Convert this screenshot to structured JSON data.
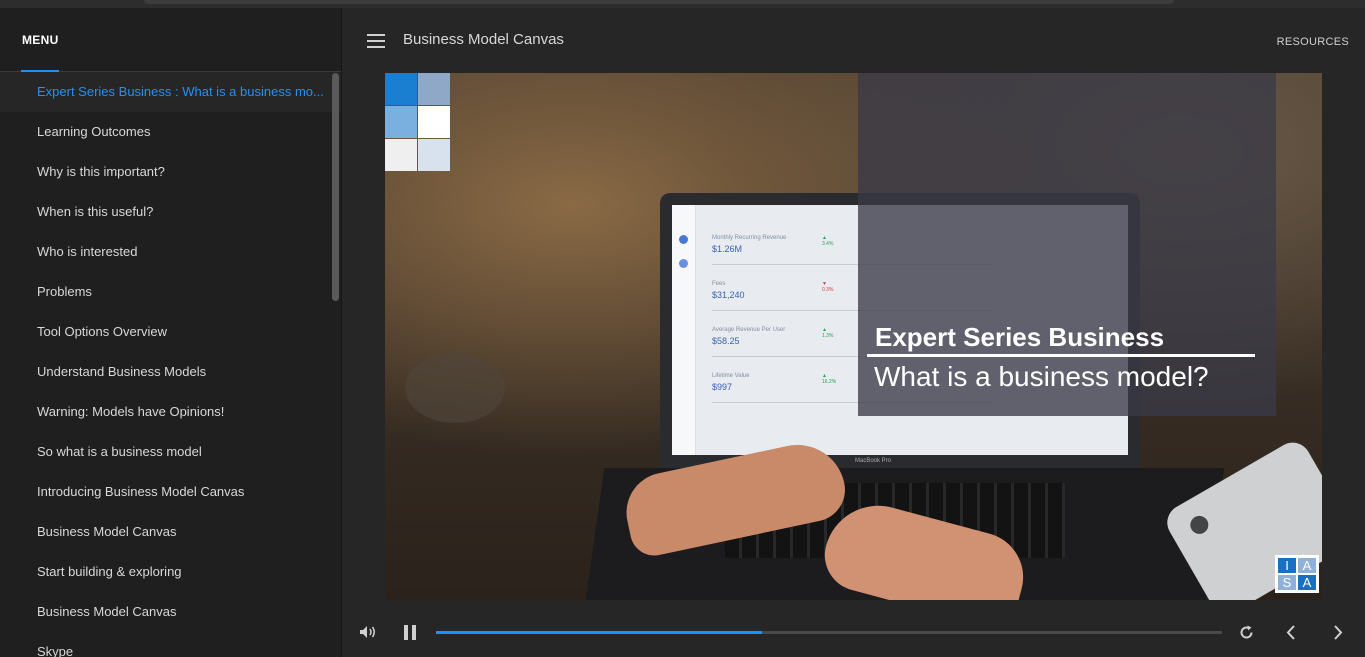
{
  "sidebar": {
    "menu_title": "MENU",
    "items": [
      {
        "label": "Expert Series Business : What is a business mo...",
        "active": true
      },
      {
        "label": "Learning Outcomes"
      },
      {
        "label": "Why is this important?"
      },
      {
        "label": "When is this useful?"
      },
      {
        "label": "Who is interested"
      },
      {
        "label": "Problems"
      },
      {
        "label": "Tool Options Overview"
      },
      {
        "label": "Understand Business Models"
      },
      {
        "label": "Warning: Models have Opinions!"
      },
      {
        "label": "So what is a business model"
      },
      {
        "label": "Introducing Business Model Canvas"
      },
      {
        "label": "Business Model Canvas"
      },
      {
        "label": "Start building & exploring"
      },
      {
        "label": "Business Model Canvas"
      },
      {
        "label": "Skype"
      }
    ]
  },
  "header": {
    "title": "Business Model Canvas",
    "resources_label": "RESOURCES"
  },
  "slide": {
    "title": "Expert Series Business",
    "subtitle": "What is a business model?",
    "logo_letters": [
      "I",
      "A",
      "S",
      "A"
    ],
    "laptop_brand": "MacBook Pro",
    "metrics": [
      {
        "label": "Monthly Recurring Revenue",
        "value": "$1.26M",
        "delta": "▲ 3.4%"
      },
      {
        "label": "Fees",
        "value": "$31,240",
        "delta": "▼ 0.3%"
      },
      {
        "label": "Average Revenue Per User",
        "value": "$58.25",
        "delta": "▲ 1.3%"
      },
      {
        "label": "Lifetime Value",
        "value": "$997",
        "delta": "▲ 16.2%"
      }
    ]
  },
  "player": {
    "progress": 0.415
  },
  "colors": {
    "accent": "#1e90ff",
    "active_item": "#2a8ef2",
    "sidebar_bg": "#1f1f1f",
    "main_bg": "#262626"
  }
}
